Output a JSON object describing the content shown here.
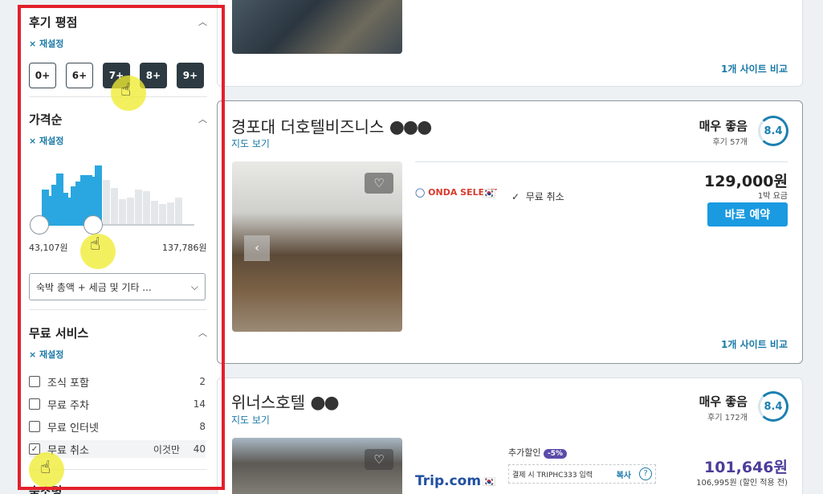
{
  "filters": {
    "review_rating": {
      "title": "후기 평점",
      "reset": "재설정",
      "options": [
        "0+",
        "6+",
        "7+",
        "8+",
        "9+"
      ]
    },
    "price": {
      "title": "가격순",
      "reset": "재설정",
      "min_label": "43,107원",
      "max_label": "137,786원",
      "histogram": [
        44,
        36,
        50,
        64,
        40,
        34,
        48,
        54,
        62,
        62,
        60,
        74
      ],
      "histogram_unselected": [
        56,
        46,
        32,
        34,
        44,
        42,
        30,
        26,
        28,
        34
      ],
      "display_option": "숙박 총액 + 세금 및 기타 ..."
    },
    "free_services": {
      "title": "무료 서비스",
      "reset": "재설정",
      "items": [
        {
          "label": "조식 포함",
          "count": "2",
          "checked": false
        },
        {
          "label": "무료 주차",
          "count": "14",
          "checked": false
        },
        {
          "label": "무료 인터넷",
          "count": "8",
          "checked": false
        },
        {
          "label": "무료 취소",
          "count": "40",
          "checked": true,
          "only": "이것만"
        }
      ]
    },
    "next_section_partial": "숙소명"
  },
  "cards": [
    {
      "compare": "1개 사이트 비교"
    },
    {
      "name": "경포대 더호텔비즈니스",
      "stars": "●●●",
      "map_link": "지도 보기",
      "rating_label": "매우 좋음",
      "reviews": "후기 57개",
      "score": "8.4",
      "provider": "ONDA SELECT",
      "free_cancel": "무료 취소",
      "price": "129,000원",
      "price_note": "1박 요금",
      "book": "바로 예약",
      "compare": "1개 사이트 비교"
    },
    {
      "name": "위너스호텔",
      "stars": "●●",
      "map_link": "지도 보기",
      "rating_label": "매우 좋음",
      "reviews": "후기 172개",
      "score": "8.4",
      "extra_discount": "추가할인",
      "discount_pct": "-5%",
      "coupon_text": "결제 시 TRIPHC333 입력",
      "copy": "복사",
      "provider": "Trip.com",
      "price": "101,646원",
      "price_note": "106,995원 (할인 적용 전)"
    }
  ],
  "colors": {
    "accent": "#1a9ae0",
    "link": "#1c7aa8",
    "frame": "#e3202c",
    "highlight": "#f0ec32"
  }
}
